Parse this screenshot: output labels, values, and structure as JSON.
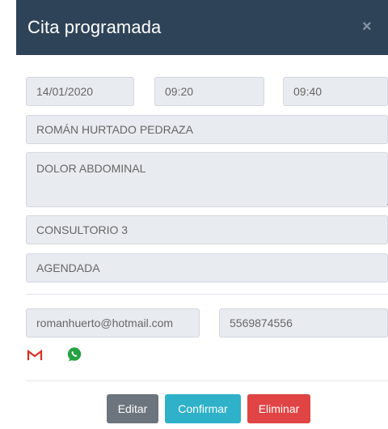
{
  "modal": {
    "title": "Cita programada",
    "close_symbol": "×"
  },
  "appointment": {
    "date": "14/01/2020",
    "start_time": "09:20",
    "end_time": "09:40",
    "patient": "ROMÁN HURTADO PEDRAZA",
    "reason": "DOLOR ABDOMINAL",
    "office": "CONSULTORIO 3",
    "status": "AGENDADA",
    "email": "romanhuerto@hotmail.com",
    "phone": "5569874556"
  },
  "contact_icons": [
    "gmail-icon",
    "whatsapp-icon"
  ],
  "actions": {
    "edit": "Editar",
    "confirm": "Confirmar",
    "delete": "Eliminar"
  },
  "colors": {
    "header_bg": "#2f4358",
    "field_bg": "#e8ebf0",
    "edit": "#6c757d",
    "confirm": "#2eb1c9",
    "delete": "#e04444",
    "gmail": "#d93025",
    "whatsapp": "#25a244"
  }
}
